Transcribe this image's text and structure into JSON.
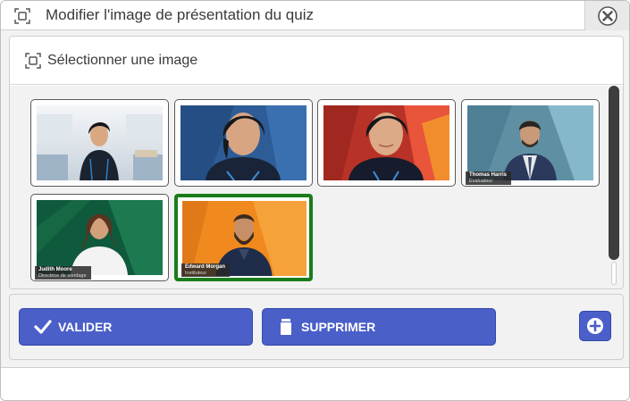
{
  "dialog": {
    "title": "Modifier l'image de présentation du quiz",
    "close_icon": "close-icon",
    "title_icon": "select-frame-icon"
  },
  "panel": {
    "title": "Sélectionner une image",
    "icon": "select-frame-icon"
  },
  "images": [
    {
      "scene": "studio-woman",
      "selected": false
    },
    {
      "scene": "woman-blue-closeup",
      "selected": false
    },
    {
      "scene": "woman-red-closeup",
      "selected": false
    },
    {
      "scene": "man-suit-teal",
      "selected": false,
      "name": "Thomas Harris",
      "role": "Evaluateur"
    },
    {
      "scene": "woman-green",
      "selected": false,
      "name": "Judith Moore",
      "role": "Directrice de sondage"
    },
    {
      "scene": "man-beard-orange",
      "selected": true,
      "name": "Edward Morgan",
      "role": "Instituteur"
    }
  ],
  "actions": {
    "validate_label": "VALIDER",
    "delete_label": "SUPPRIMER",
    "add_icon": "plus-circle-icon"
  },
  "colors": {
    "button": "#4a5fc8",
    "selected_border": "#1a7d1a",
    "background": "#f2f2f2"
  }
}
